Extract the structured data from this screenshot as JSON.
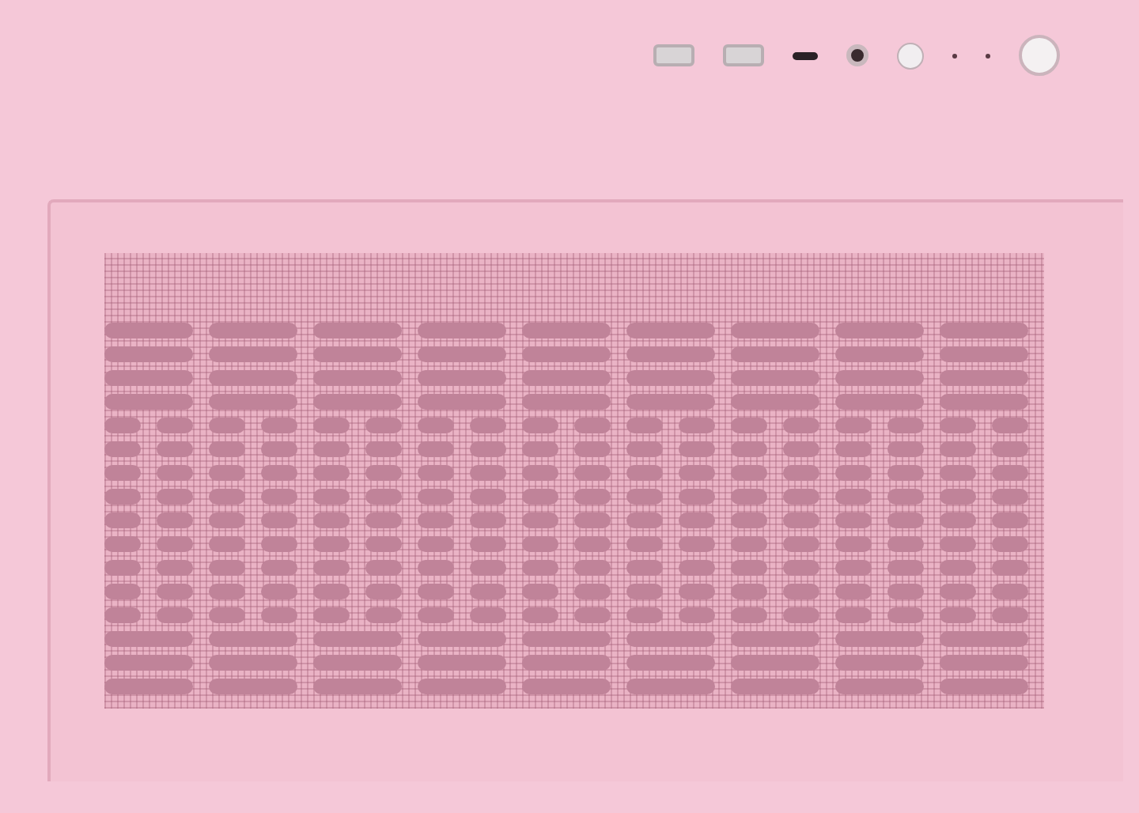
{
  "front_io": {
    "ports": [
      {
        "kind": "usb-a"
      },
      {
        "kind": "usb-a"
      },
      {
        "kind": "usb-c"
      },
      {
        "kind": "audio-jack"
      },
      {
        "kind": "reset-button"
      },
      {
        "kind": "led"
      },
      {
        "kind": "led"
      },
      {
        "kind": "power-button"
      }
    ]
  }
}
